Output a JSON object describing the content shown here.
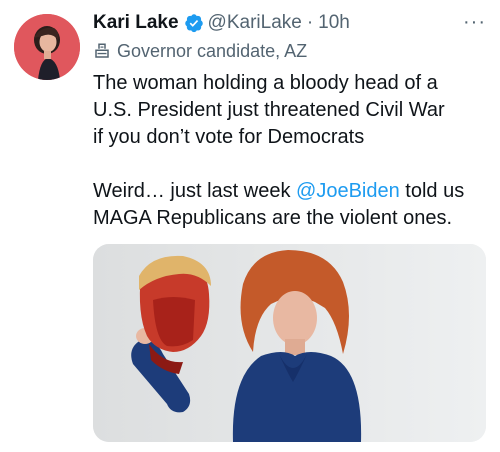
{
  "tweet": {
    "author_name": "Kari Lake",
    "handle": "@KariLake",
    "separator": "·",
    "time": "10h",
    "label": "Governor candidate, AZ",
    "text_line_1": "The woman holding a bloody head of a",
    "text_line_2": "U.S. President just threatened Civil War",
    "text_line_3": "if you don’t vote for Democrats",
    "text_line_4_pre": "Weird… just last week ",
    "mention": "@JoeBiden",
    "text_line_4_post": " told us",
    "text_line_5": "MAGA Republicans are the violent ones.",
    "more_label": "···"
  },
  "icons": {
    "verified": "verified-badge-icon",
    "label": "ballot-box-icon",
    "more": "more-options-icon"
  },
  "colors": {
    "verified_badge": "#1d9bf0",
    "mention": "#1d9bf0",
    "secondary_text": "#536471",
    "primary_text": "#0f1419"
  }
}
